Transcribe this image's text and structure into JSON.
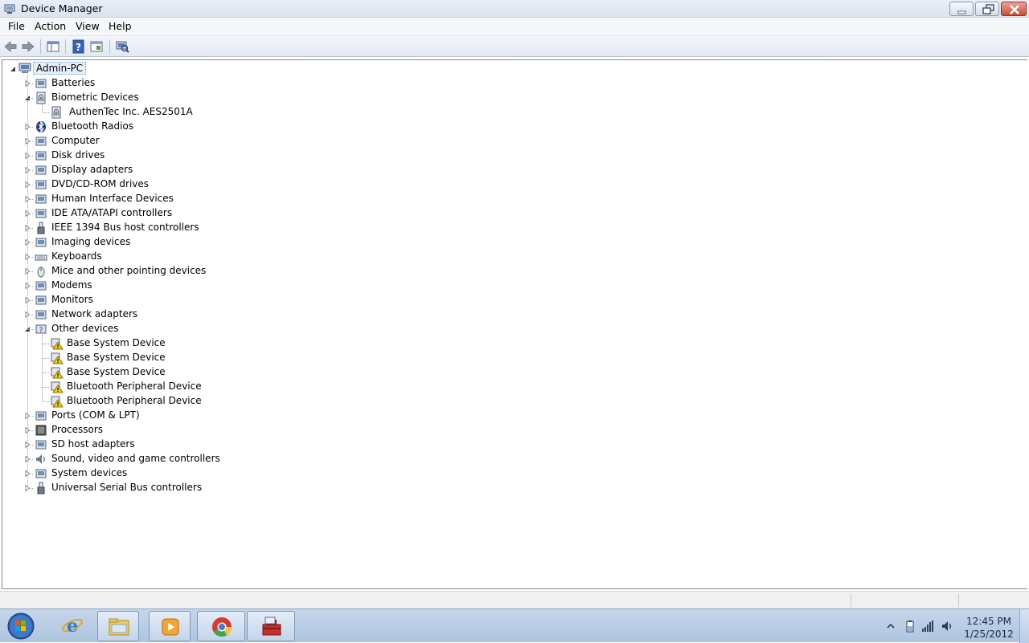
{
  "window": {
    "title": "Device Manager"
  },
  "menu": [
    "File",
    "Action",
    "View",
    "Help"
  ],
  "toolbar": {
    "buttons": [
      "back-arrow-icon",
      "forward-arrow-icon",
      "properties-icon",
      "help-icon",
      "show-hide-console-tree-icon",
      "scan-hardware-icon"
    ]
  },
  "tree": {
    "root": "Admin-PC",
    "nodes": [
      {
        "label": "Batteries",
        "expanded": false,
        "icon": "battery-icon"
      },
      {
        "label": "Biometric Devices",
        "expanded": true,
        "icon": "fingerprint-icon",
        "children": [
          {
            "label": "AuthenTec Inc. AES2501A",
            "icon": "fingerprint-icon",
            "warning": false
          }
        ]
      },
      {
        "label": "Bluetooth Radios",
        "expanded": false,
        "icon": "bluetooth-icon"
      },
      {
        "label": "Computer",
        "expanded": false,
        "icon": "computer-icon"
      },
      {
        "label": "Disk drives",
        "expanded": false,
        "icon": "disk-drive-icon"
      },
      {
        "label": "Display adapters",
        "expanded": false,
        "icon": "display-adapter-icon"
      },
      {
        "label": "DVD/CD-ROM drives",
        "expanded": false,
        "icon": "dvd-drive-icon"
      },
      {
        "label": "Human Interface Devices",
        "expanded": false,
        "icon": "hid-icon"
      },
      {
        "label": "IDE ATA/ATAPI controllers",
        "expanded": false,
        "icon": "ide-controller-icon"
      },
      {
        "label": "IEEE 1394 Bus host controllers",
        "expanded": false,
        "icon": "firewire-icon"
      },
      {
        "label": "Imaging devices",
        "expanded": false,
        "icon": "camera-icon"
      },
      {
        "label": "Keyboards",
        "expanded": false,
        "icon": "keyboard-icon"
      },
      {
        "label": "Mice and other pointing devices",
        "expanded": false,
        "icon": "mouse-icon"
      },
      {
        "label": "Modems",
        "expanded": false,
        "icon": "modem-icon"
      },
      {
        "label": "Monitors",
        "expanded": false,
        "icon": "monitor-icon"
      },
      {
        "label": "Network adapters",
        "expanded": false,
        "icon": "network-adapter-icon"
      },
      {
        "label": "Other devices",
        "expanded": true,
        "icon": "unknown-device-icon",
        "children": [
          {
            "label": "Base System Device",
            "icon": "warning-device-icon",
            "warning": true
          },
          {
            "label": "Base System Device",
            "icon": "warning-device-icon",
            "warning": true
          },
          {
            "label": "Base System Device",
            "icon": "warning-device-icon",
            "warning": true
          },
          {
            "label": "Bluetooth Peripheral Device",
            "icon": "warning-device-icon",
            "warning": true
          },
          {
            "label": "Bluetooth Peripheral Device",
            "icon": "warning-device-icon",
            "warning": true
          }
        ]
      },
      {
        "label": "Ports (COM & LPT)",
        "expanded": false,
        "icon": "port-icon"
      },
      {
        "label": "Processors",
        "expanded": false,
        "icon": "processor-icon"
      },
      {
        "label": "SD host adapters",
        "expanded": false,
        "icon": "sd-adapter-icon"
      },
      {
        "label": "Sound, video and game controllers",
        "expanded": false,
        "icon": "speaker-icon"
      },
      {
        "label": "System devices",
        "expanded": false,
        "icon": "system-device-icon"
      },
      {
        "label": "Universal Serial Bus controllers",
        "expanded": false,
        "icon": "usb-icon"
      }
    ]
  },
  "taskbar": {
    "items": [
      "start-orb-icon",
      "internet-explorer-icon",
      "windows-explorer-icon",
      "media-player-icon",
      "chrome-icon",
      "device-manager-toolbox-icon"
    ],
    "clock": {
      "time": "12:45 PM",
      "date": "1/25/2012"
    },
    "tray": [
      "show-hidden-icons-chevron-icon",
      "battery-tray-icon",
      "signal-strength-icon",
      "volume-icon"
    ]
  },
  "colors": {
    "warning_yellow": "#f5d20f",
    "selection_bg": "#e6f0fb",
    "tree_line": "#a0a0a0"
  }
}
